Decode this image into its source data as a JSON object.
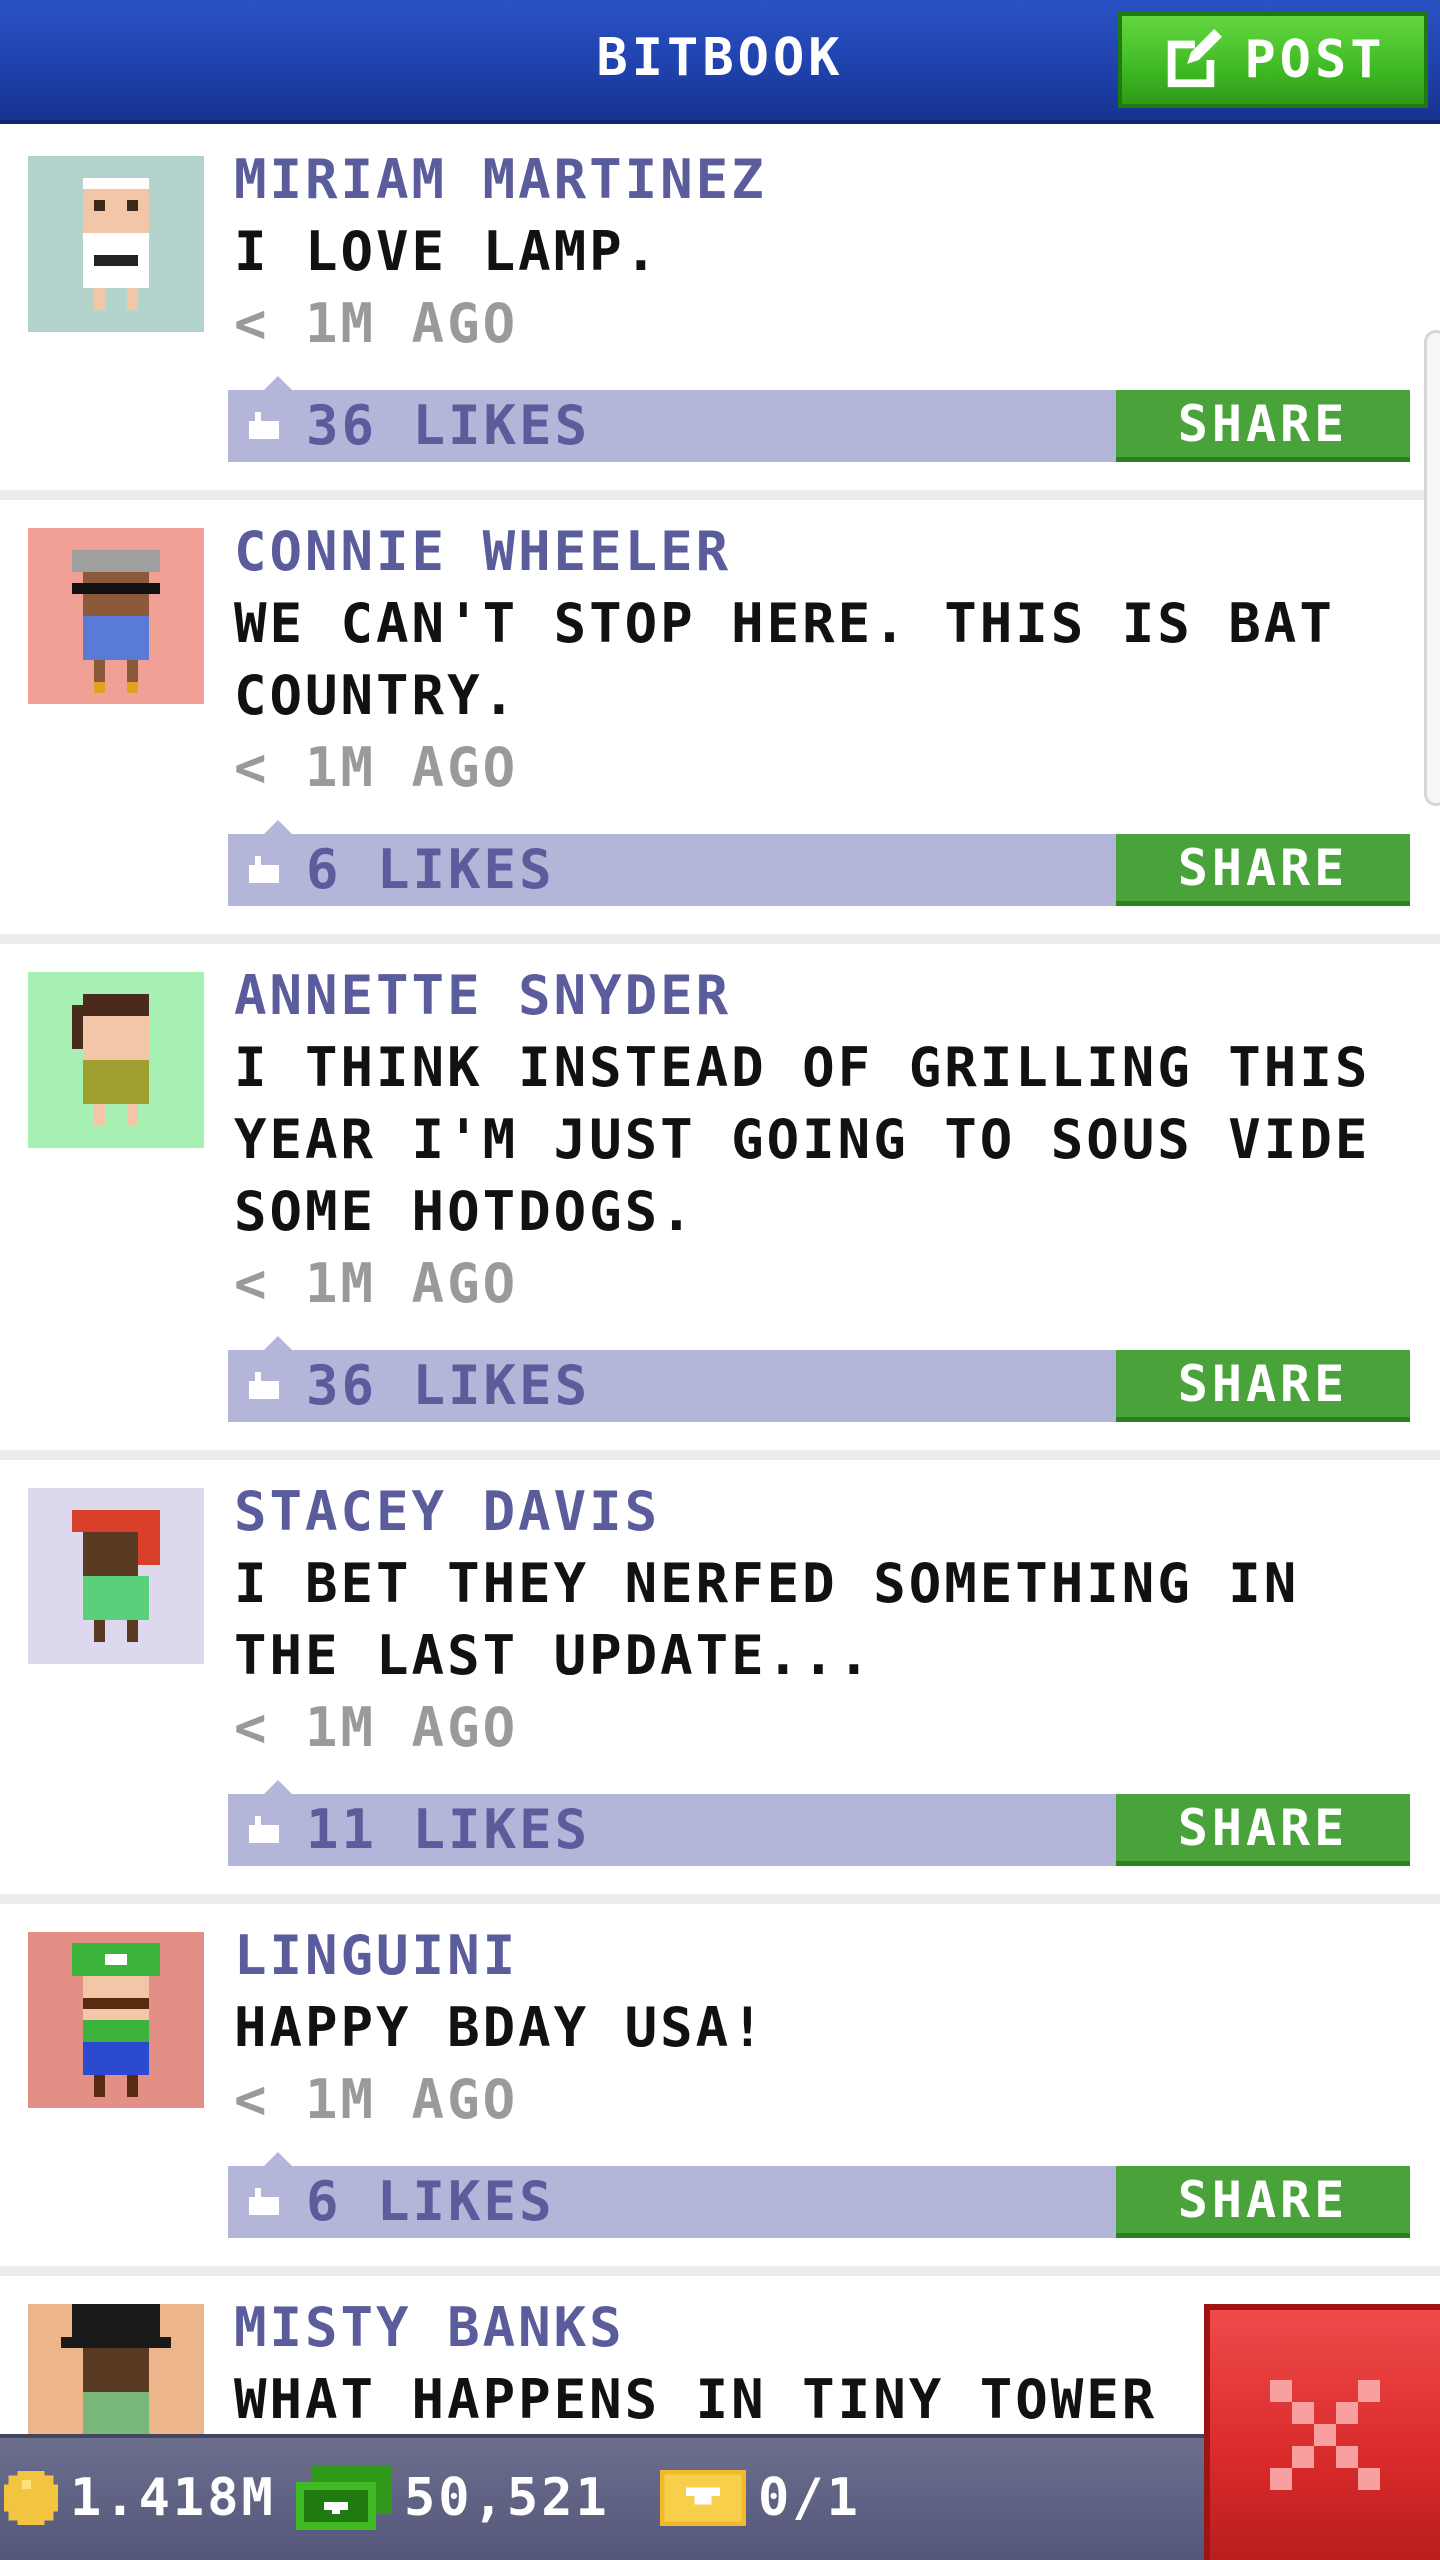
{
  "header": {
    "title": "BITBOOK",
    "post_label": "POST"
  },
  "posts": [
    {
      "author": "MIRIAM MARTINEZ",
      "message": "I LOVE LAMP.",
      "time": "< 1M AGO",
      "likes": "36 LIKES",
      "share": "SHARE",
      "avatar_bg": "#b4d3cd"
    },
    {
      "author": "CONNIE WHEELER",
      "message": "WE CAN'T STOP HERE. THIS IS BAT COUNTRY.",
      "time": "< 1M AGO",
      "likes": "6 LIKES",
      "share": "SHARE",
      "avatar_bg": "#f0a095"
    },
    {
      "author": "ANNETTE SNYDER",
      "message": "I THINK INSTEAD OF GRILLING THIS YEAR I'M JUST GOING TO SOUS VIDE SOME HOTDOGS.",
      "time": "< 1M AGO",
      "likes": "36 LIKES",
      "share": "SHARE",
      "avatar_bg": "#a6f0b3"
    },
    {
      "author": "STACEY DAVIS",
      "message": "I BET THEY NERFED SOMETHING IN THE LAST UPDATE...",
      "time": "< 1M AGO",
      "likes": "11 LIKES",
      "share": "SHARE",
      "avatar_bg": "#ddd8ee"
    },
    {
      "author": "LINGUINI",
      "message": "HAPPY BDAY USA!",
      "time": "< 1M AGO",
      "likes": "6 LIKES",
      "share": "SHARE",
      "avatar_bg": "#e38f86"
    },
    {
      "author": "MISTY BANKS",
      "message": "WHAT HAPPENS IN TINY TOWER",
      "time": "",
      "likes": "",
      "share": "",
      "avatar_bg": "#edb58a"
    }
  ],
  "status_bar": {
    "coins": "1.418M",
    "bux": "50,521",
    "tickets": "0/1"
  },
  "colors": {
    "header_blue": "#2347b8",
    "post_green": "#3fba24",
    "likes_bar": "#b3b6d8",
    "author_text": "#5b5c9c",
    "share_green": "#4aa33a",
    "close_red": "#d92a2a"
  },
  "icons": {
    "post": "edit-icon",
    "like": "thumbs-up-icon",
    "coin": "coin-icon",
    "bux": "bux-icon",
    "ticket": "ticket-icon",
    "close": "close-icon"
  }
}
